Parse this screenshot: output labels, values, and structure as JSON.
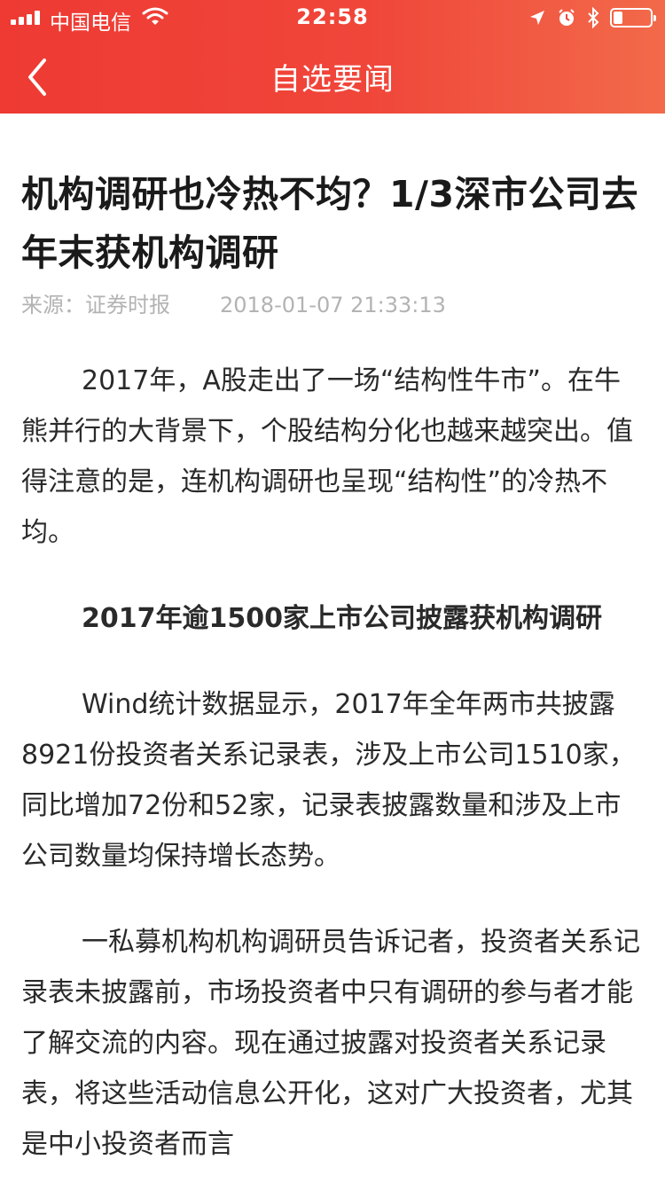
{
  "status_bar": {
    "carrier": "中国电信",
    "time": "22:58",
    "battery_level": 0.25,
    "icons": [
      "signal-icon",
      "wifi-icon",
      "location-icon",
      "alarm-icon",
      "bluetooth-icon",
      "battery-icon"
    ]
  },
  "nav": {
    "title": "自选要闻",
    "back_icon": "chevron-left-icon"
  },
  "article": {
    "title": "机构调研也冷热不均？1/3深市公司去年末获机构调研",
    "source": "来源：证券时报",
    "date": "2018-01-07 21:33:13",
    "paragraphs": [
      "2017年，A股走出了一场“结构性牛市”。在牛熊并行的大背景下，个股结构分化也越来越突出。值得注意的是，连机构调研也呈现“结构性”的冷热不均。",
      "2017年逾1500家上市公司披露获机构调研",
      "Wind统计数据显示，2017年全年两市共披露8921份投资者关系记录表，涉及上市公司1510家，同比增加72份和52家，记录表披露数量和涉及上市公司数量均保持增长态势。",
      "一私募机构机构调研员告诉记者，投资者关系记录表未披露前，市场投资者中只有调研的参与者才能了解交流的内容。现在通过披露对投资者关系记录表，将这些活动信息公开化，这对广大投资者，尤其是中小投资者而言"
    ]
  },
  "colors": {
    "header_start": "#ee3a33",
    "header_end": "#f26a4a",
    "meta_text": "#b3b3b3",
    "body_text": "#2a2a2a"
  }
}
